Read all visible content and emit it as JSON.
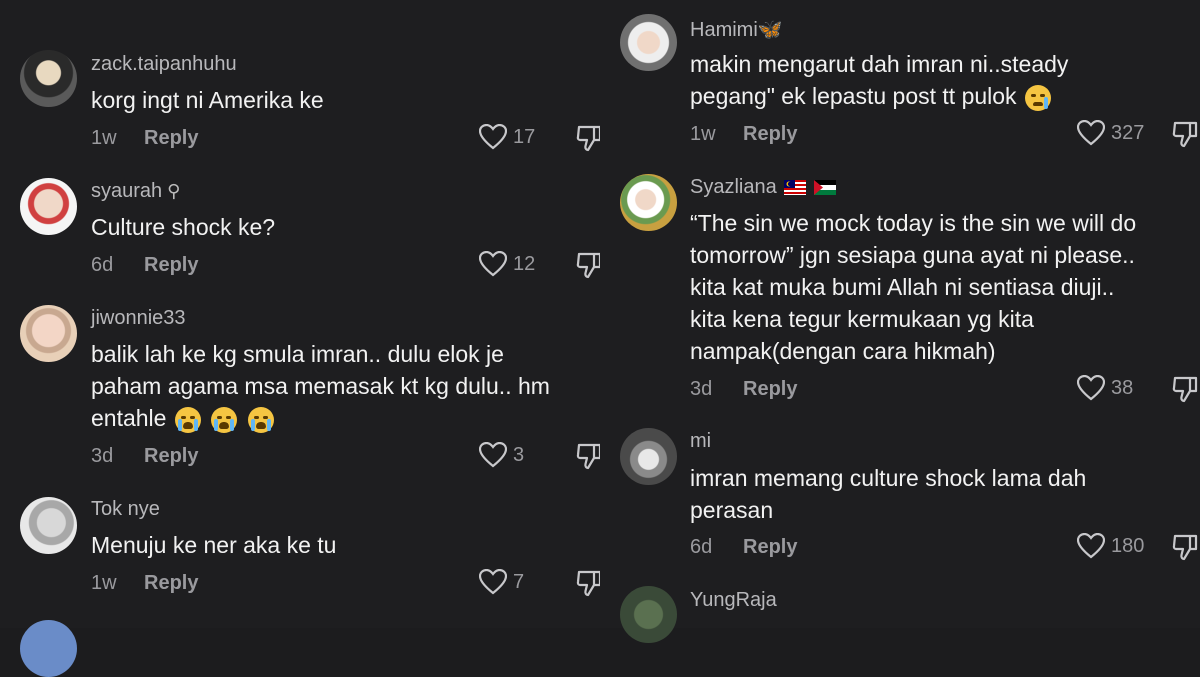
{
  "left": [
    {
      "username": "zack.taipanhuhu",
      "text": "korg ingt ni Amerika ke",
      "age": "1w",
      "reply": "Reply",
      "likes": "17"
    },
    {
      "username": "syaurah",
      "text": "Culture shock ke?",
      "age": "6d",
      "reply": "Reply",
      "likes": "12"
    },
    {
      "username": "jiwonnie33",
      "text_line1": "balik lah ke kg smula imran.. dulu elok je",
      "text_line2": "paham agama msa memasak kt kg dulu.. hm",
      "text_line3": "entahle",
      "age": "3d",
      "reply": "Reply",
      "likes": "3"
    },
    {
      "username": "Tok nye",
      "text": "Menuju ke ner aka ke tu",
      "age": "1w",
      "reply": "Reply",
      "likes": "7"
    }
  ],
  "right": [
    {
      "username": "Hamimi",
      "text_line1": "makin mengarut dah imran ni..steady",
      "text_line2": "pegang\" ek lepastu post tt pulok",
      "age": "1w",
      "reply": "Reply",
      "likes": "327"
    },
    {
      "username": "Syazliana",
      "text_line1": "“The sin we mock today is the sin we will do",
      "text_line2": "tomorrow” jgn sesiapa guna ayat ni please..",
      "text_line3": "kita kat muka bumi Allah ni sentiasa diuji..",
      "text_line4": "kita kena tegur kermukaan yg kita",
      "text_line5": "nampak(dengan cara hikmah)",
      "age": "3d",
      "reply": "Reply",
      "likes": "38"
    },
    {
      "username": "mi",
      "text_line1": "imran memang culture shock lama dah",
      "text_line2": "perasan",
      "age": "6d",
      "reply": "Reply",
      "likes": "180"
    },
    {
      "username": "YungRaja"
    }
  ],
  "colors": {
    "background": "#1e1e20",
    "username": "#b8b8bb",
    "text": "#f2f2f2",
    "meta": "#9a9a9e"
  }
}
